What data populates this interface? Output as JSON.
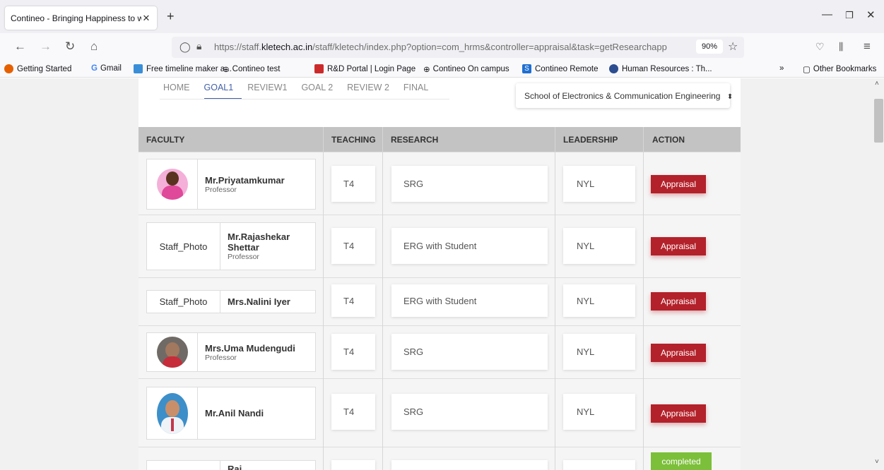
{
  "browser": {
    "tab_title": "Contineo - Bringing Happiness to w",
    "url_prefix": "https://staff.",
    "url_domain": "kletech.ac.in",
    "url_rest": "/staff/kletech/index.php?option=com_hrms&controller=appraisal&task=getResearchapp",
    "zoom": "90%",
    "bookmarks": [
      "Getting Started",
      "Gmail",
      "Free timeline maker a...",
      "Contineo test",
      "R&D Portal | Login Page",
      "Contineo On campus",
      "Contineo Remote",
      "Human Resources : Th..."
    ],
    "other_bookmarks": "Other Bookmarks"
  },
  "subnav": [
    "HOME",
    "GOAL1",
    "REVIEW1",
    "GOAL 2",
    "REVIEW 2",
    "FINAL"
  ],
  "school_select": "School of Electronics & Communication Engineering",
  "columns": {
    "faculty": "FACULTY",
    "teaching": "TEACHING",
    "research": "RESEARCH",
    "leadership": "LEADERSHIP",
    "action": "ACTION"
  },
  "rows": [
    {
      "photo": "",
      "name": "Mr.Priyatamkumar",
      "role": "Professor",
      "teaching": "T4",
      "research": "SRG",
      "leadership": "NYL",
      "action": "Appraisal"
    },
    {
      "photo": "Staff_Photo",
      "name": "Mr.Rajashekar Shettar",
      "role": "Professor",
      "teaching": "T4",
      "research": "ERG with Student",
      "leadership": "NYL",
      "action": "Appraisal"
    },
    {
      "photo": "Staff_Photo",
      "name": "Mrs.Nalini Iyer",
      "role": "",
      "teaching": "T4",
      "research": "ERG with Student",
      "leadership": "NYL",
      "action": "Appraisal"
    },
    {
      "photo": "",
      "name": "Mrs.Uma Mudengudi",
      "role": "Professor",
      "teaching": "T4",
      "research": "SRG",
      "leadership": "NYL",
      "action": "Appraisal"
    },
    {
      "photo": "",
      "name": "Mr.Anil Nandi",
      "role": "",
      "teaching": "T4",
      "research": "SRG",
      "leadership": "NYL",
      "action": "Appraisal"
    },
    {
      "name": "Raj...",
      "action": "completed"
    }
  ]
}
